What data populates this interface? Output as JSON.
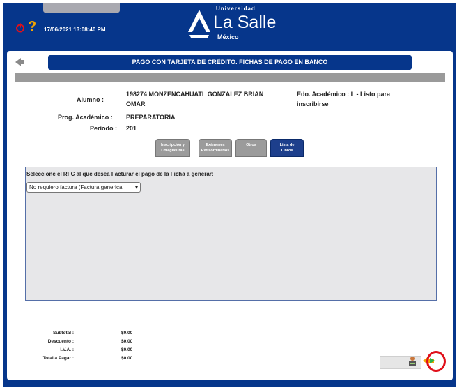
{
  "header": {
    "datetime": "17/06/2021 13:08:40 PM",
    "logo": {
      "university": "Universidad",
      "name": "La Salle",
      "country": "México"
    },
    "icons": [
      "power-icon",
      "help-icon"
    ]
  },
  "page": {
    "title": "PAGO CON TARJETA DE CRÉDITO. FICHAS DE PAGO EN BANCO"
  },
  "student": {
    "alumno_label": "Alumno :",
    "alumno_value_line1": "198274 MONZENCAHUATL GONZALEZ BRIAN",
    "alumno_value_line2": "OMAR",
    "prog_label": "Prog. Académico :",
    "prog_value": "PREPARATORIA",
    "periodo_label": "Periodo :",
    "periodo_value": "201",
    "edo_label_line1": "Edo. Académico : L - Listo para",
    "edo_label_line2": "inscribirse"
  },
  "tabs": [
    {
      "label_line1": "Inscripción y",
      "label_line2": "Colegiaturas",
      "active": false
    },
    {
      "label_line1": "Exámenes",
      "label_line2": "Extraordinarios",
      "active": false
    },
    {
      "label_line1": "Otros",
      "label_line2": "",
      "active": false
    },
    {
      "label_line1": "Lista de",
      "label_line2": "Libros",
      "active": true
    }
  ],
  "rfc": {
    "prompt": "Seleccione el RFC al que desea Facturar el pago de la Ficha a generar:",
    "selected": "No requiero factura (Factura generica"
  },
  "totals": [
    {
      "label": "Subtotal :",
      "value": "$0.00"
    },
    {
      "label": "Descuento :",
      "value": "$0.00"
    },
    {
      "label": "I.V.A. :",
      "value": "$0.00"
    },
    {
      "label": "Total a Pagar :",
      "value": "$0.00"
    }
  ],
  "colors": {
    "navy": "#06368b",
    "accent_orange": "#f5a500",
    "highlight": "#e0101a",
    "next_green": "#2bb24c"
  }
}
